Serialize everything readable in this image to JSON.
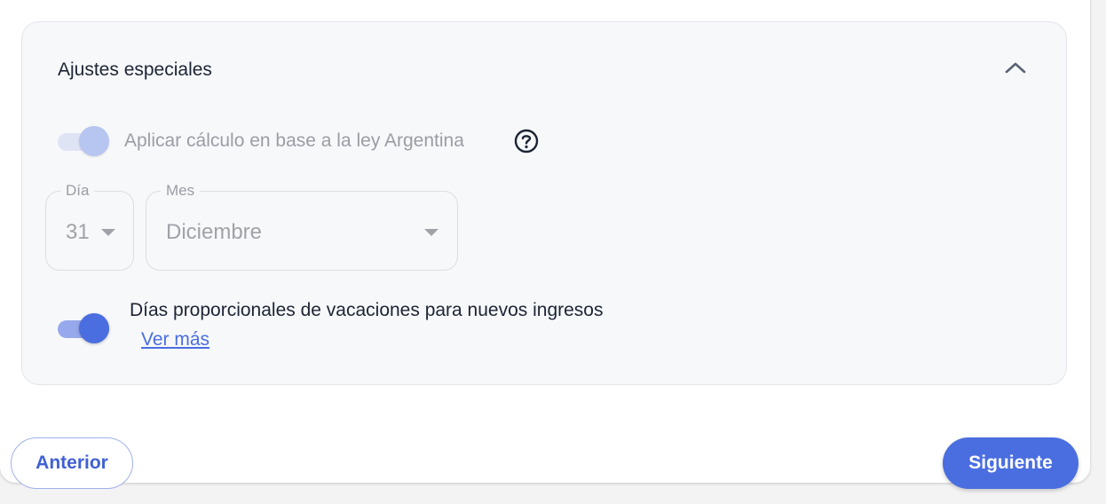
{
  "special_settings": {
    "title": "Ajustes especiales",
    "collapse_icon": "chevron-up-icon",
    "argentina_law": {
      "label": "Aplicar cálculo en base a la ley Argentina",
      "enabled": true,
      "disabled": true,
      "help_icon": "question-circle-icon"
    },
    "day_select": {
      "legend": "Día",
      "value": "31"
    },
    "month_select": {
      "legend": "Mes",
      "value": "Diciembre"
    },
    "proportional_days": {
      "label": "Días proporcionales de vacaciones para nuevos ingresos",
      "enabled": true,
      "link": "Ver más"
    }
  },
  "footer": {
    "back_label": "Anterior",
    "next_label": "Siguiente"
  },
  "colors": {
    "accent": "#4a6ee0",
    "panel_bg": "#f7f8fa",
    "text": "#1c2434",
    "muted": "#9a9da4"
  }
}
